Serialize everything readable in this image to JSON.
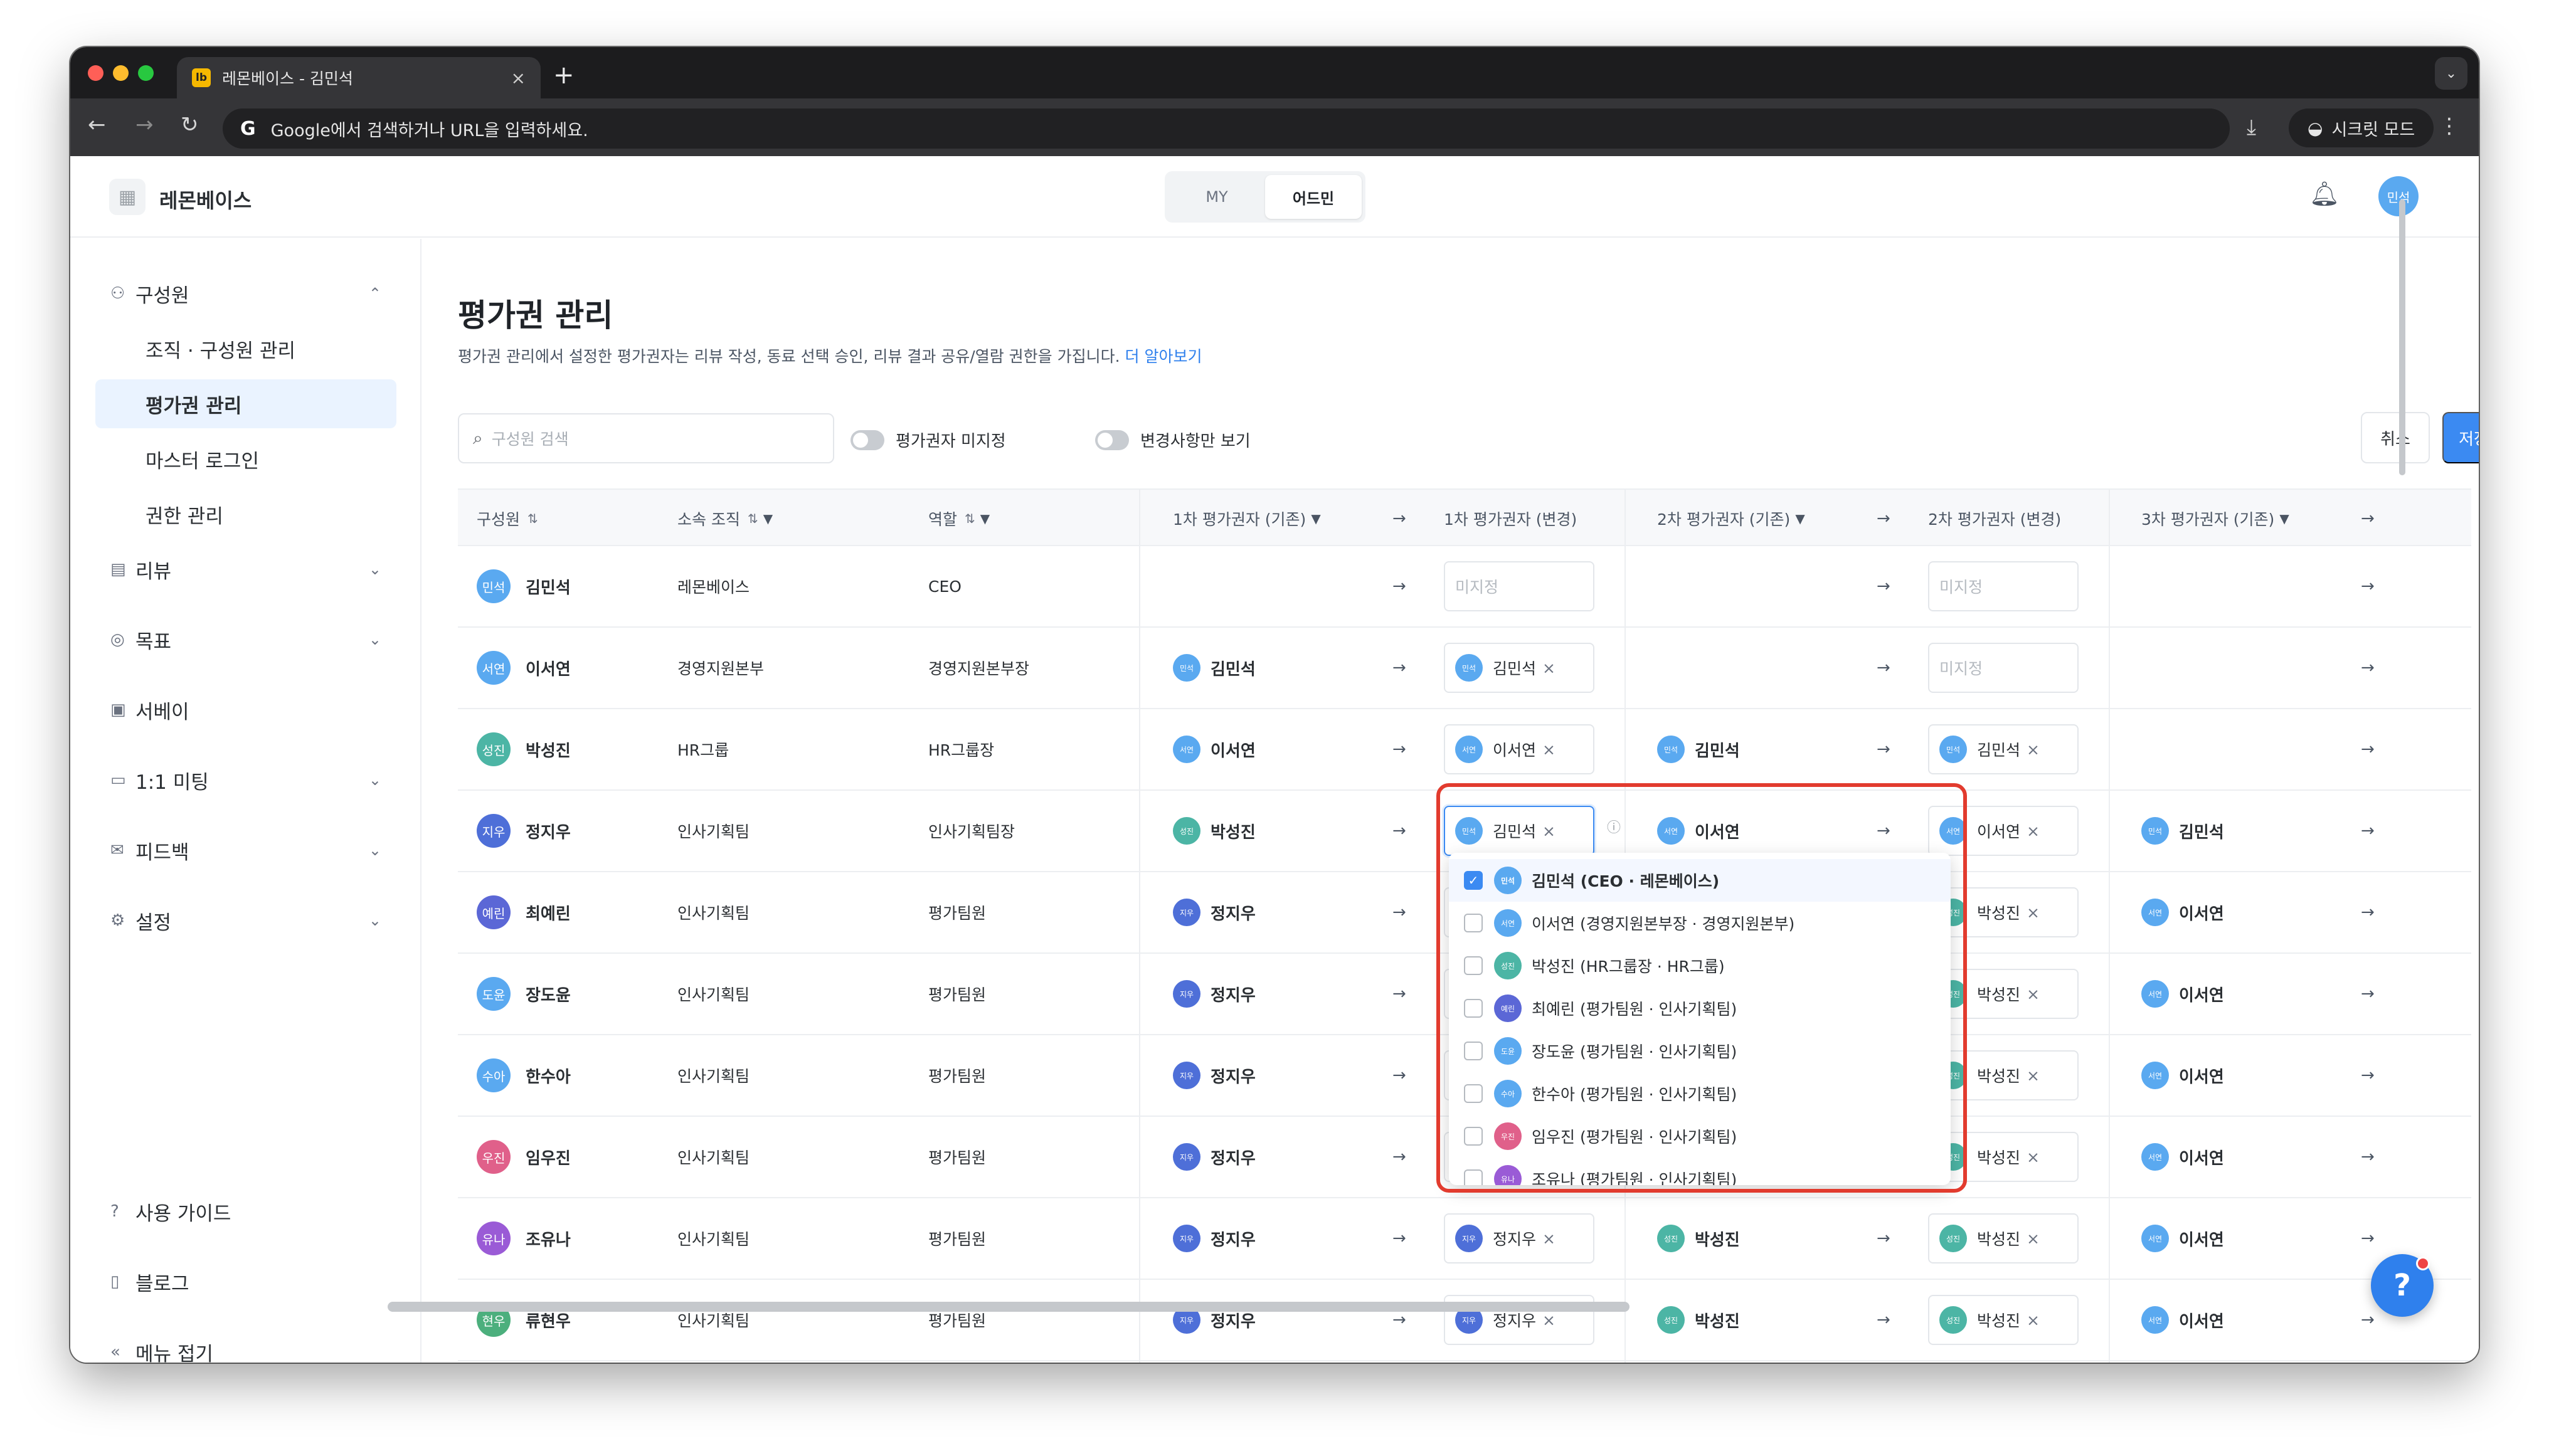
{
  "browser": {
    "tab_title": "레몬베이스 - 김민석",
    "tab_favicon": "lb",
    "new_tab": "+",
    "address_text": "Google에서 검색하거나 URL을 입력하세요.",
    "incognito_label": "시크릿 모드"
  },
  "app": {
    "brand": "레몬베이스",
    "modes": [
      "MY",
      "어드민"
    ],
    "user_avatar": "민석"
  },
  "sidebar": {
    "items": [
      {
        "label": "구성원",
        "icon": "person-icon",
        "chevron": "⌃"
      },
      {
        "label": "조직 · 구성원 관리",
        "sub": true
      },
      {
        "label": "평가권 관리",
        "sub": true,
        "active": true
      },
      {
        "label": "마스터 로그인",
        "sub": true
      },
      {
        "label": "권한 관리",
        "sub": true
      },
      {
        "label": "리뷰",
        "icon": "review-icon",
        "chevron": "⌄"
      },
      {
        "label": "목표",
        "icon": "target-icon",
        "chevron": "⌄"
      },
      {
        "label": "서베이",
        "icon": "survey-icon"
      },
      {
        "label": "1:1 미팅",
        "icon": "calendar-icon",
        "chevron": "⌄"
      },
      {
        "label": "피드백",
        "icon": "mail-icon",
        "chevron": "⌄"
      },
      {
        "label": "설정",
        "icon": "gear-icon",
        "chevron": "⌄"
      }
    ],
    "bottom": [
      {
        "label": "사용 가이드",
        "icon": "help-circle-icon"
      },
      {
        "label": "블로그",
        "icon": "book-icon"
      },
      {
        "label": "메뉴 접기",
        "icon": "collapse-icon"
      }
    ]
  },
  "page": {
    "title": "평가권 관리",
    "description": "평가권 관리에서 설정한 평가권자는 리뷰 작성, 동료 선택 승인, 리뷰 결과 공유/열람 권한을 가집니다.",
    "learn_more": "더 알아보기",
    "search_placeholder": "구성원 검색",
    "toggle_unassigned": "평가권자 미지정",
    "toggle_changes": "변경사항만 보기",
    "cancel": "취소",
    "save": "저장"
  },
  "table": {
    "headers": [
      "구성원",
      "소속 조직",
      "역할",
      "1차 평가권자 (기존)",
      "1차 평가권자 (변경)",
      "2차 평가권자 (기존)",
      "2차 평가권자 (변경)",
      "3차 평가권자 (기존)"
    ],
    "unassigned": "미지정",
    "arrow": "→",
    "rows": [
      {
        "name": "김민석",
        "av": "민석",
        "c": "c-blue",
        "org": "레몬베이스",
        "role": "CEO",
        "e1": null,
        "n1": null,
        "e2": null,
        "n2": null,
        "e3": null
      },
      {
        "name": "이서연",
        "av": "서연",
        "c": "c-blue",
        "org": "경영지원본부",
        "role": "경영지원본부장",
        "e1": {
          "n": "김민석",
          "av": "민석",
          "c": "c-blue"
        },
        "n1": {
          "n": "김민석",
          "av": "민석",
          "c": "c-blue"
        },
        "e2": null,
        "n2": null,
        "e3": null
      },
      {
        "name": "박성진",
        "av": "성진",
        "c": "c-teal",
        "org": "HR그룹",
        "role": "HR그룹장",
        "e1": {
          "n": "이서연",
          "av": "서연",
          "c": "c-blue"
        },
        "n1": {
          "n": "이서연",
          "av": "서연",
          "c": "c-blue"
        },
        "e2": {
          "n": "김민석",
          "av": "민석",
          "c": "c-blue"
        },
        "n2": {
          "n": "김민석",
          "av": "민석",
          "c": "c-blue"
        },
        "e3": null
      },
      {
        "name": "정지우",
        "av": "지우",
        "c": "c-royal",
        "org": "인사기획팀",
        "role": "인사기획팀장",
        "e1": {
          "n": "박성진",
          "av": "성진",
          "c": "c-teal"
        },
        "n1": {
          "n": "김민석",
          "av": "민석",
          "c": "c-blue"
        },
        "e2": {
          "n": "이서연",
          "av": "서연",
          "c": "c-blue"
        },
        "n2": {
          "n": "이서연",
          "av": "서연",
          "c": "c-blue"
        },
        "e3": {
          "n": "김민석",
          "av": "민석",
          "c": "c-blue"
        }
      },
      {
        "name": "최예린",
        "av": "예린",
        "c": "c-indigo",
        "org": "인사기획팀",
        "role": "평가팀원",
        "e1": {
          "n": "정지우",
          "av": "지우",
          "c": "c-royal"
        },
        "n1": null,
        "e2": null,
        "n2": {
          "n": "박성진",
          "av": "성진",
          "c": "c-teal"
        },
        "e3": {
          "n": "이서연",
          "av": "서연",
          "c": "c-blue"
        }
      },
      {
        "name": "장도윤",
        "av": "도윤",
        "c": "c-blue",
        "org": "인사기획팀",
        "role": "평가팀원",
        "e1": {
          "n": "정지우",
          "av": "지우",
          "c": "c-royal"
        },
        "n1": null,
        "e2": null,
        "n2": {
          "n": "박성진",
          "av": "성진",
          "c": "c-teal"
        },
        "e3": {
          "n": "이서연",
          "av": "서연",
          "c": "c-blue"
        }
      },
      {
        "name": "한수아",
        "av": "수아",
        "c": "c-blue",
        "org": "인사기획팀",
        "role": "평가팀원",
        "e1": {
          "n": "정지우",
          "av": "지우",
          "c": "c-royal"
        },
        "n1": null,
        "e2": null,
        "n2": {
          "n": "박성진",
          "av": "성진",
          "c": "c-teal"
        },
        "e3": {
          "n": "이서연",
          "av": "서연",
          "c": "c-blue"
        }
      },
      {
        "name": "임우진",
        "av": "우진",
        "c": "c-pink",
        "org": "인사기획팀",
        "role": "평가팀원",
        "e1": {
          "n": "정지우",
          "av": "지우",
          "c": "c-royal"
        },
        "n1": null,
        "e2": null,
        "n2": {
          "n": "박성진",
          "av": "성진",
          "c": "c-teal"
        },
        "e3": {
          "n": "이서연",
          "av": "서연",
          "c": "c-blue"
        }
      },
      {
        "name": "조유나",
        "av": "유나",
        "c": "c-purple",
        "org": "인사기획팀",
        "role": "평가팀원",
        "e1": {
          "n": "정지우",
          "av": "지우",
          "c": "c-royal"
        },
        "n1": {
          "n": "정지우",
          "av": "지우",
          "c": "c-royal"
        },
        "e2": {
          "n": "박성진",
          "av": "성진",
          "c": "c-teal"
        },
        "n2": {
          "n": "박성진",
          "av": "성진",
          "c": "c-teal"
        },
        "e3": {
          "n": "이서연",
          "av": "서연",
          "c": "c-blue"
        }
      },
      {
        "name": "류현우",
        "av": "현우",
        "c": "c-green",
        "org": "인사기획팀",
        "role": "평가팀원",
        "e1": {
          "n": "정지우",
          "av": "지우",
          "c": "c-royal"
        },
        "n1": {
          "n": "정지우",
          "av": "지우",
          "c": "c-royal"
        },
        "e2": {
          "n": "박성진",
          "av": "성진",
          "c": "c-teal"
        },
        "n2": {
          "n": "박성진",
          "av": "성진",
          "c": "c-teal"
        },
        "e3": {
          "n": "이서연",
          "av": "서연",
          "c": "c-blue"
        }
      }
    ]
  },
  "dropdown": {
    "items": [
      {
        "label": "김민석 (CEO · 레몬베이스)",
        "av": "민석",
        "c": "c-blue",
        "checked": true
      },
      {
        "label": "이서연 (경영지원본부장 · 경영지원본부)",
        "av": "서연",
        "c": "c-blue",
        "checked": false
      },
      {
        "label": "박성진 (HR그룹장 · HR그룹)",
        "av": "성진",
        "c": "c-teal",
        "checked": false
      },
      {
        "label": "최예린 (평가팀원 · 인사기획팀)",
        "av": "예린",
        "c": "c-indigo",
        "checked": false
      },
      {
        "label": "장도윤 (평가팀원 · 인사기획팀)",
        "av": "도윤",
        "c": "c-blue",
        "checked": false
      },
      {
        "label": "한수아 (평가팀원 · 인사기획팀)",
        "av": "수아",
        "c": "c-blue",
        "checked": false
      },
      {
        "label": "임우진 (평가팀원 · 인사기획팀)",
        "av": "우진",
        "c": "c-pink",
        "checked": false
      },
      {
        "label": "조유나 (평가팀원 · 인사기획팀)",
        "av": "유나",
        "c": "c-purple",
        "checked": false
      }
    ]
  },
  "help_button": "?"
}
